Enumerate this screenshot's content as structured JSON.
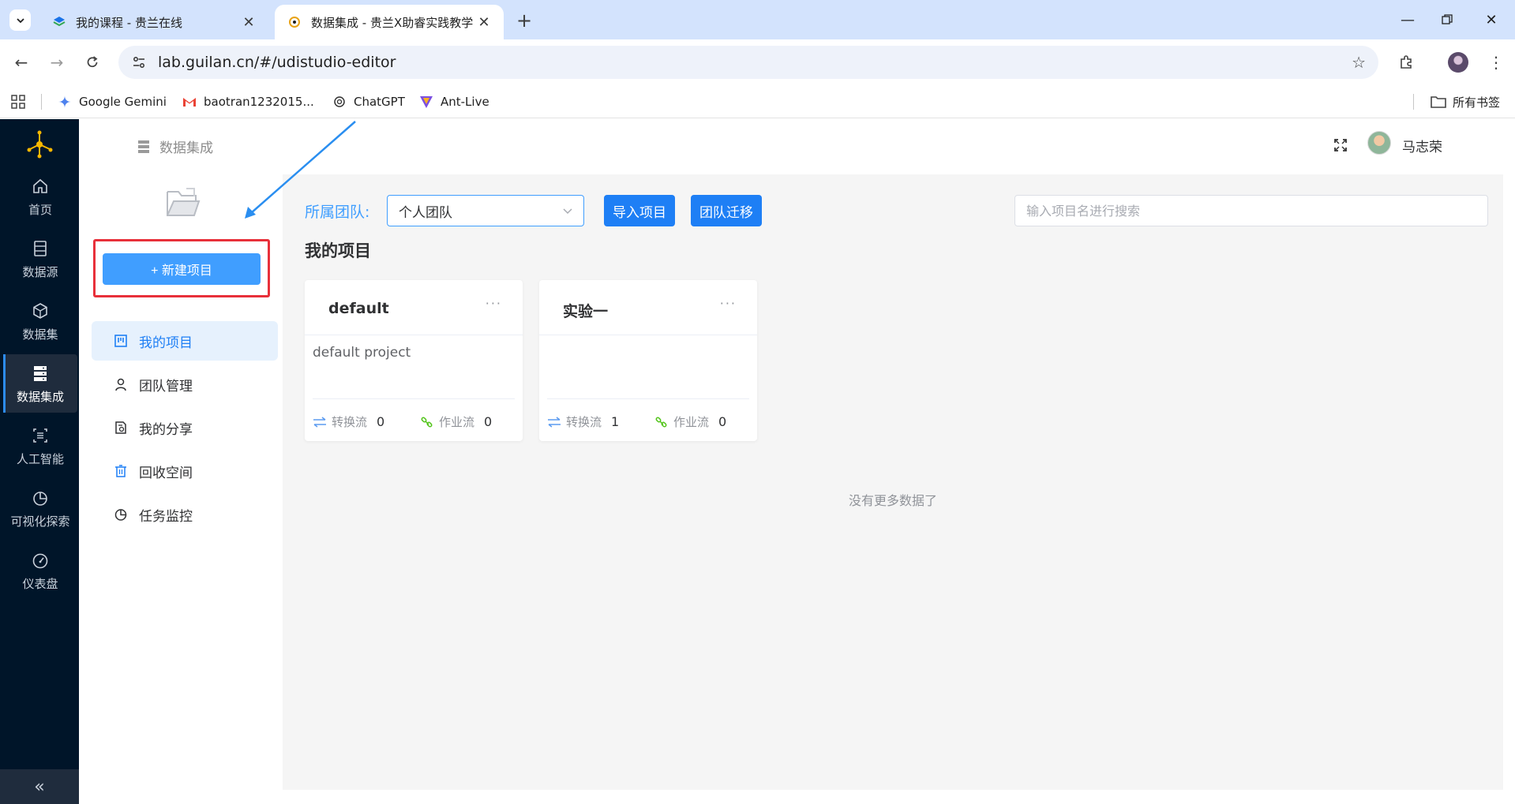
{
  "browser": {
    "tabs": [
      {
        "title": "我的课程 - 贵兰在线",
        "active": false
      },
      {
        "title": "数据集成 - 贵兰X助睿实践教学",
        "active": true
      }
    ],
    "url": "lab.guilan.cn/#/udistudio-editor",
    "bookmarks": [
      {
        "label": "Google Gemini",
        "icon": "gemini-icon"
      },
      {
        "label": "baotran1232015...",
        "icon": "gmail-icon"
      },
      {
        "label": "ChatGPT",
        "icon": "chatgpt-icon"
      },
      {
        "label": "Ant-Live",
        "icon": "ant-live-icon"
      }
    ],
    "all_bookmarks_label": "所有书签"
  },
  "rail": {
    "items": [
      {
        "label": "首页",
        "icon": "home-icon",
        "active": false
      },
      {
        "label": "数据源",
        "icon": "datasource-icon",
        "active": false
      },
      {
        "label": "数据集",
        "icon": "cube-icon",
        "active": false
      },
      {
        "label": "数据集成",
        "icon": "server-icon",
        "active": true
      },
      {
        "label": "人工智能",
        "icon": "ai-icon",
        "active": false
      },
      {
        "label": "可视化探索",
        "icon": "pie-icon",
        "active": false
      },
      {
        "label": "仪表盘",
        "icon": "dashboard-icon",
        "active": false
      }
    ],
    "collapse_glyph": "«"
  },
  "topbar": {
    "breadcrumb": "数据集成",
    "username": "马志荣"
  },
  "leftpanel": {
    "new_button": "+ 新建项目",
    "menu": [
      {
        "label": "我的项目",
        "icon": "project-icon",
        "active": true
      },
      {
        "label": "团队管理",
        "icon": "user-icon",
        "active": false
      },
      {
        "label": "我的分享",
        "icon": "share-icon",
        "active": false
      },
      {
        "label": "回收空间",
        "icon": "trash-icon",
        "active": false
      },
      {
        "label": "任务监控",
        "icon": "monitor-icon",
        "active": false
      }
    ]
  },
  "main": {
    "team_label": "所属团队:",
    "team_value": "个人团队",
    "import_button": "导入项目",
    "migrate_button": "团队迁移",
    "search_placeholder": "输入项目名进行搜索",
    "section_title": "我的项目",
    "projects": [
      {
        "name": "default",
        "description": "default project",
        "transform_label": "转换流",
        "transform_count": "0",
        "job_label": "作业流",
        "job_count": "0"
      },
      {
        "name": "实验一",
        "description": "",
        "transform_label": "转换流",
        "transform_count": "1",
        "job_label": "作业流",
        "job_count": "0"
      }
    ],
    "no_more": "没有更多数据了"
  },
  "colors": {
    "rail_bg": "#001529",
    "primary": "#1e7ff5",
    "accent_light": "#409eff",
    "highlight_box": "#e8303a",
    "annotation_arrow": "#2a8ef0"
  }
}
